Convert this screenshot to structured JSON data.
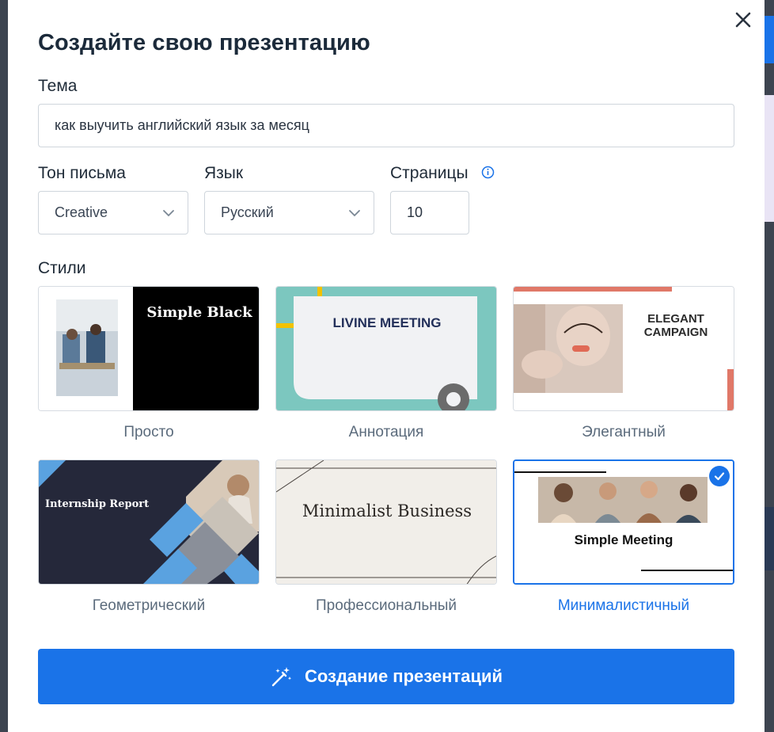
{
  "modal": {
    "title": "Создайте свою презентацию",
    "close_icon": "close-icon"
  },
  "topic": {
    "label": "Тема",
    "value": "как выучить английский язык за месяц"
  },
  "tone": {
    "label": "Тон письма",
    "value": "Creative"
  },
  "language": {
    "label": "Язык",
    "value": "Русский"
  },
  "pages": {
    "label": "Страницы",
    "value": "10",
    "info_icon": "info-icon"
  },
  "styles": {
    "label": "Стили",
    "items": [
      {
        "label": "Просто",
        "preview_text": "Simple Black",
        "selected": false
      },
      {
        "label": "Аннотация",
        "preview_text": "LIVINE MEETING",
        "selected": false
      },
      {
        "label": "Элегантный",
        "preview_text_1": "ELEGANT",
        "preview_text_2": "CAMPAIGN",
        "selected": false
      },
      {
        "label": "Геометрический",
        "preview_text": "Internship Report",
        "selected": false
      },
      {
        "label": "Профессиональный",
        "preview_text": "Minimalist Business",
        "selected": false
      },
      {
        "label": "Минималистичный",
        "preview_text": "Simple Meeting",
        "selected": true
      }
    ]
  },
  "create_button": {
    "label": "Создание презентаций",
    "icon": "magic-wand-icon"
  },
  "colors": {
    "accent": "#1a73e8",
    "title": "#1b2a3a",
    "card_label": "#5b6b7c"
  }
}
